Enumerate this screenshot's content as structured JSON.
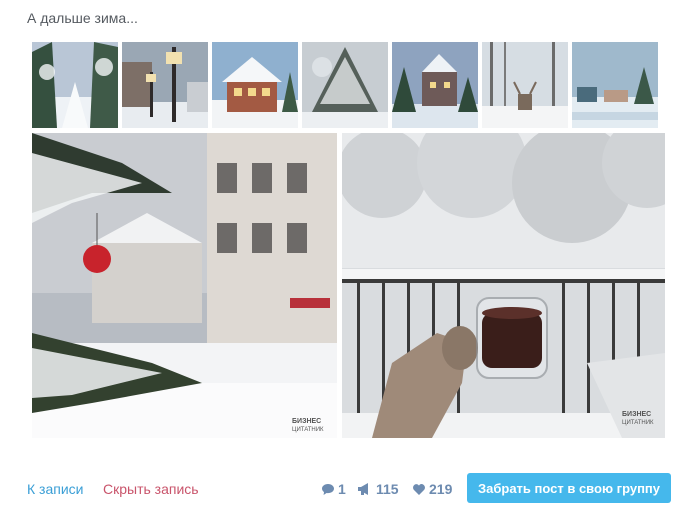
{
  "post": {
    "title": "А дальше зима..."
  },
  "thumbnails": [
    {
      "name": "snowy-forest-path",
      "sky": "#b9c6d6",
      "ground": "#eef2f6",
      "accent": "#35503f"
    },
    {
      "name": "snowy-street-lamps",
      "sky": "#9aa7b4",
      "ground": "#e8ecf0",
      "accent": "#2e2a2a"
    },
    {
      "name": "snowy-house",
      "sky": "#8fb0cf",
      "ground": "#f2f4f6",
      "accent": "#a35a43"
    },
    {
      "name": "snowy-pine-branch",
      "sky": "#c7cdd2",
      "ground": "#eceff2",
      "accent": "#55605a"
    },
    {
      "name": "snowy-castle",
      "sky": "#8ea3bf",
      "ground": "#dde6ee",
      "accent": "#6e5a58"
    },
    {
      "name": "snowy-deer-forest",
      "sky": "#d6dde3",
      "ground": "#f4f5f6",
      "accent": "#7a6a5c"
    },
    {
      "name": "snowy-village-lake",
      "sky": "#9fb9cc",
      "ground": "#e3ecf2",
      "accent": "#4a6b7c"
    }
  ],
  "photos": [
    {
      "name": "christmas-street",
      "watermark": "БИЗНЕС ЦИТАТНИК"
    },
    {
      "name": "coffee-on-balcony",
      "watermark": "БИЗНЕС ЦИТАТНИК"
    }
  ],
  "footer": {
    "to_post": "К записи",
    "hide_post": "Скрыть запись",
    "comments_count": "1",
    "reposts_count": "115",
    "likes_count": "219",
    "take_post_button": "Забрать пост в свою группу"
  },
  "colors": {
    "link_blue": "#3b9fd6",
    "link_red": "#c9546b",
    "stat_color": "#6d8bb0",
    "button_bg": "#45b8ec"
  }
}
